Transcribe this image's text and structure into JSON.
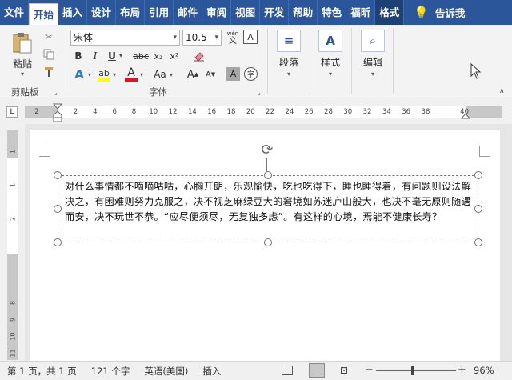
{
  "tabs": [
    {
      "label": "文件",
      "active": false
    },
    {
      "label": "开始",
      "active": true
    },
    {
      "label": "插入",
      "active": false
    },
    {
      "label": "设计",
      "active": false
    },
    {
      "label": "布局",
      "active": false
    },
    {
      "label": "引用",
      "active": false
    },
    {
      "label": "邮件",
      "active": false
    },
    {
      "label": "审阅",
      "active": false
    },
    {
      "label": "视图",
      "active": false
    },
    {
      "label": "开发",
      "active": false
    },
    {
      "label": "帮助",
      "active": false
    },
    {
      "label": "特色",
      "active": false
    },
    {
      "label": "福昕",
      "active": false
    },
    {
      "label": "格式",
      "active": false
    }
  ],
  "tell_me": "告诉我",
  "clipboard": {
    "paste_label": "粘贴",
    "group_label": "剪贴板"
  },
  "font": {
    "font_name": "宋体",
    "font_size": "10.5",
    "group_label": "字体",
    "bold": "B",
    "italic": "I",
    "underline": "U",
    "strikethrough": "abc",
    "subscript": "x₂",
    "superscript": "x²",
    "grow": "A",
    "shrink": "A",
    "case": "Aa",
    "wen_label": "wén"
  },
  "paragraph": {
    "label": "段落"
  },
  "styles": {
    "label": "样式"
  },
  "editing": {
    "label": "编辑"
  },
  "ruler": {
    "corner": "L",
    "ticks": [
      "2",
      "",
      "2",
      "4",
      "6",
      "8",
      "10",
      "12",
      "14",
      "16",
      "18",
      "20",
      "22",
      "24",
      "26",
      "28",
      "30",
      "32",
      "34",
      "36",
      "38",
      "",
      "40"
    ]
  },
  "vruler": {
    "ticks": [
      "1",
      "",
      "1",
      "",
      "2",
      "",
      "",
      "",
      "",
      "8",
      "9",
      "10",
      "11"
    ]
  },
  "document": {
    "textbox_text": "对什么事情都不嘀嘀咕咕，心胸开朗，乐观愉快，吃也吃得下，睡也睡得着，有问题则设法解决之，有困难则努力克服之，决不视芝麻绿豆大的窘境如苏迷庐山般大，也决不毫无原则随遇而安，决不玩世不恭。“应尽便须尽，无复独多虑”。有这样的心境，焉能不健康长寿？"
  },
  "status": {
    "page": "第 1 页，共 1 页",
    "words": "121 个字",
    "language": "英语(美国)",
    "mode": "插入",
    "zoom": "96%"
  },
  "colors": {
    "accent": "#2b579a",
    "highlight": "#ffff00",
    "font_color": "#e81123"
  }
}
